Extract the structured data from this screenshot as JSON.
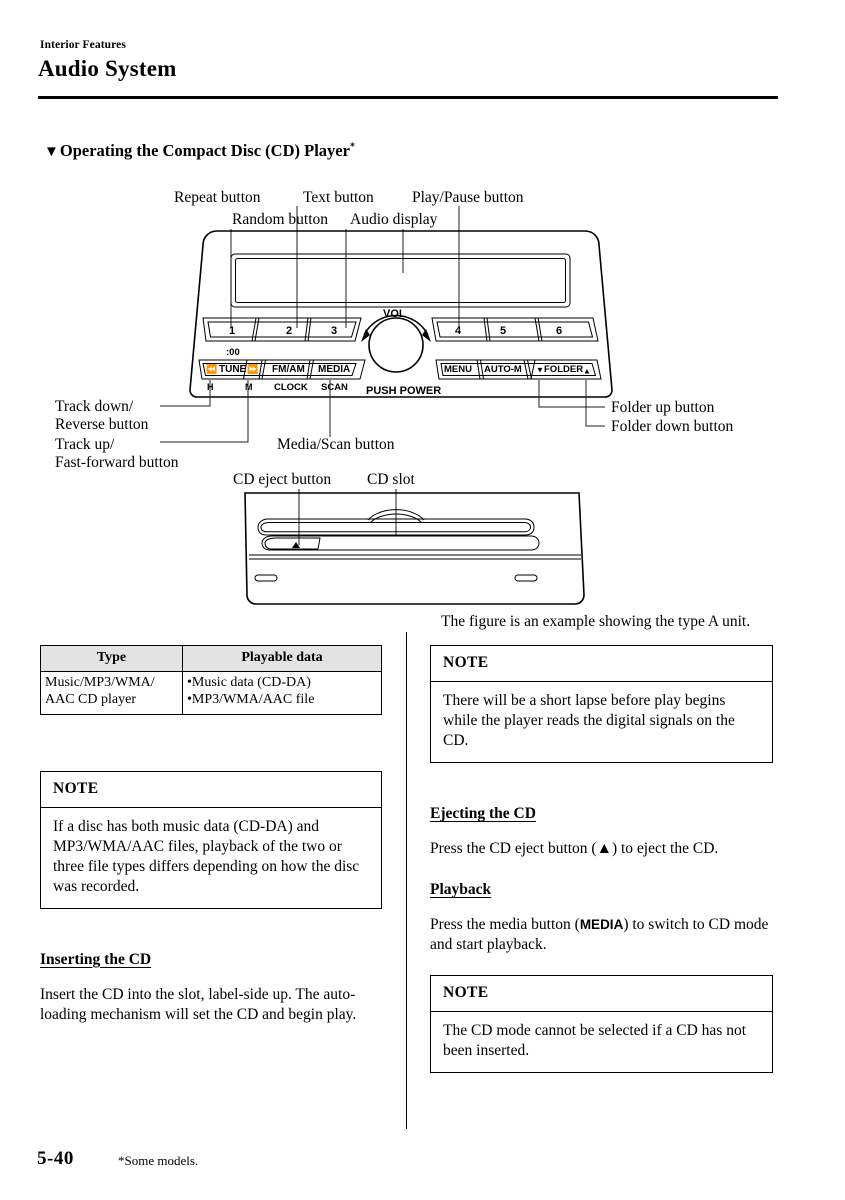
{
  "header": {
    "category": "Interior Features",
    "title": "Audio System"
  },
  "section": {
    "triangle": "▼",
    "heading": "Operating the Compact Disc (CD) Player",
    "asterisk": "*"
  },
  "figure": {
    "callouts": {
      "repeat_button": "Repeat button",
      "text_button": "Text button",
      "play_pause_button": "Play/Pause button",
      "random_button": "Random button",
      "audio_display": "Audio display",
      "track_down_l1": "Track down/",
      "track_down_l2": "Reverse button",
      "track_up_l1": "Track up/",
      "track_up_l2": "Fast-forward button",
      "media_scan_button": "Media/Scan button",
      "folder_up_button": "Folder up button",
      "folder_down_button": "Folder down button",
      "cd_eject_button": "CD eject button",
      "cd_slot": "CD slot"
    },
    "unit_labels": {
      "preset1": "1",
      "preset2": "2",
      "preset3": "3",
      "preset4": "4",
      "preset5": "5",
      "preset6": "6",
      "clock_min": ":00",
      "tune": "TUNE",
      "tune_prev_icon": "⏮",
      "tune_next_icon": "⏭",
      "fm_am": "FM/AM",
      "media": "MEDIA",
      "h": "H",
      "m": "M",
      "clock": "CLOCK",
      "scan": "SCAN",
      "vol": "VOL",
      "push_power": "PUSH POWER",
      "menu": "MENU",
      "auto_m": "AUTO-M",
      "folder": "FOLDER",
      "folder_down_icon": "▼",
      "folder_up_icon": "▲",
      "eject_icon": "▲"
    },
    "caption": "The figure is an example showing the type A unit."
  },
  "table": {
    "headers": [
      "Type",
      "Playable data"
    ],
    "rows": [
      {
        "type_line1": "Music/MP3/WMA/",
        "type_line2": "AAC CD player",
        "data_line1": "•Music data (CD-DA)",
        "data_line2": "•MP3/WMA/AAC file"
      }
    ]
  },
  "left_column": {
    "note1": {
      "title": "NOTE",
      "body": "If a disc has both music data (CD-DA) and MP3/WMA/AAC files, playback of the two or three file types differs depending on how the disc was recorded."
    },
    "inserting": {
      "heading": "Inserting the CD",
      "body": "Insert the CD into the slot, label-side up. The auto-loading mechanism will set the CD and begin play."
    }
  },
  "right_column": {
    "note1": {
      "title": "NOTE",
      "body": "There will be a short lapse before play begins while the player reads the digital signals on the CD."
    },
    "ejecting": {
      "heading": "Ejecting the CD",
      "body_before": "Press the CD eject button (",
      "icon": "▲",
      "body_after": ") to eject the CD."
    },
    "playback": {
      "heading": "Playback",
      "body_before": "Press the media button (",
      "media_label": "MEDIA",
      "body_after": ") to switch to CD mode and start playback."
    },
    "note2": {
      "title": "NOTE",
      "body": "The CD mode cannot be selected if a CD has not been inserted."
    }
  },
  "footer": {
    "page_number": "5-40",
    "note": "*Some models."
  }
}
